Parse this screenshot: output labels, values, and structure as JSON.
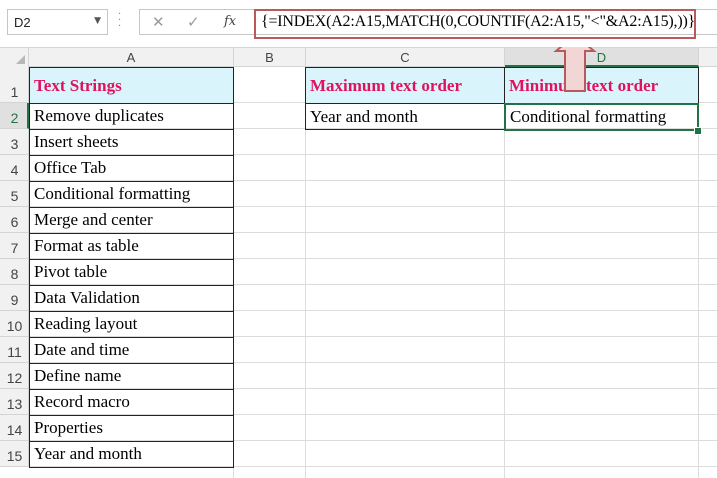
{
  "formula_bar": {
    "name_box": "D2",
    "cancel_icon": "✕",
    "enter_icon": "✓",
    "fx_label": "fx",
    "formula": "{=INDEX(A2:A15,MATCH(0,COUNTIF(A2:A15,\"<\"&A2:A15),))}"
  },
  "columns": [
    "A",
    "B",
    "C",
    "D"
  ],
  "rows": [
    "1",
    "2",
    "3",
    "4",
    "5",
    "6",
    "7",
    "8",
    "9",
    "10",
    "11",
    "12",
    "13",
    "14",
    "15"
  ],
  "cells": {
    "A1": "Text Strings",
    "C1": "Maximum text order",
    "D1": "Minimum text order",
    "C2": "Year and month",
    "D2": "Conditional formatting"
  },
  "text_strings": [
    "Remove duplicates",
    "Insert sheets",
    "Office Tab",
    "Conditional formatting",
    "Merge and center",
    "Format as table",
    "Pivot table",
    "Data Validation",
    "Reading layout",
    "Date and time",
    "Define name",
    "Record macro",
    "Properties",
    "Year and month"
  ],
  "colors": {
    "header_fill": "#d9f5fb",
    "header_text": "#e0115f",
    "selection": "#217346",
    "annotation": "#b95a5a"
  }
}
